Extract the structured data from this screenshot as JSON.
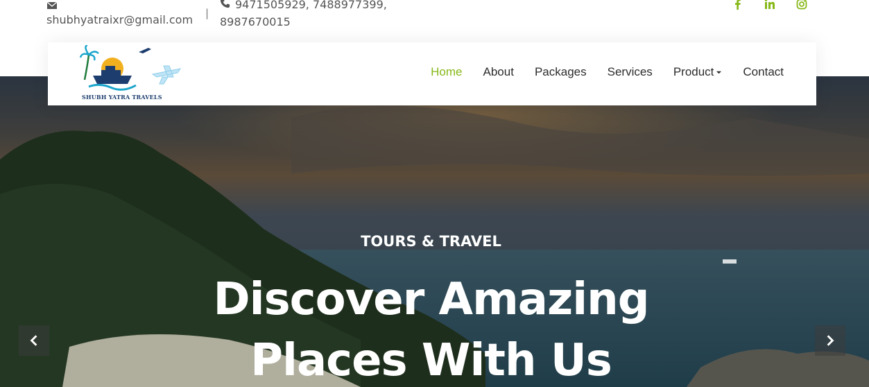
{
  "topbar": {
    "email": "shubhyatraixr@gmail.com",
    "separator": "|",
    "phone_line1": "9471505929, 7488977399,",
    "phone_line2": "8987670015",
    "social_icons": [
      "facebook-icon",
      "linkedin-icon",
      "instagram-icon"
    ]
  },
  "brand": {
    "logo_text": "SHUBH YATRA TRAVELS"
  },
  "nav": {
    "items": [
      {
        "label": "Home",
        "active": true
      },
      {
        "label": "About"
      },
      {
        "label": "Packages"
      },
      {
        "label": "Services"
      },
      {
        "label": "Product",
        "dropdown": true
      },
      {
        "label": "Contact"
      }
    ]
  },
  "hero": {
    "subtitle": "TOURS & TRAVEL",
    "title_line1": "Discover Amazing",
    "title_line2": "Places With Us"
  },
  "colors": {
    "accent": "#86b817",
    "text": "#2b2b2b"
  }
}
